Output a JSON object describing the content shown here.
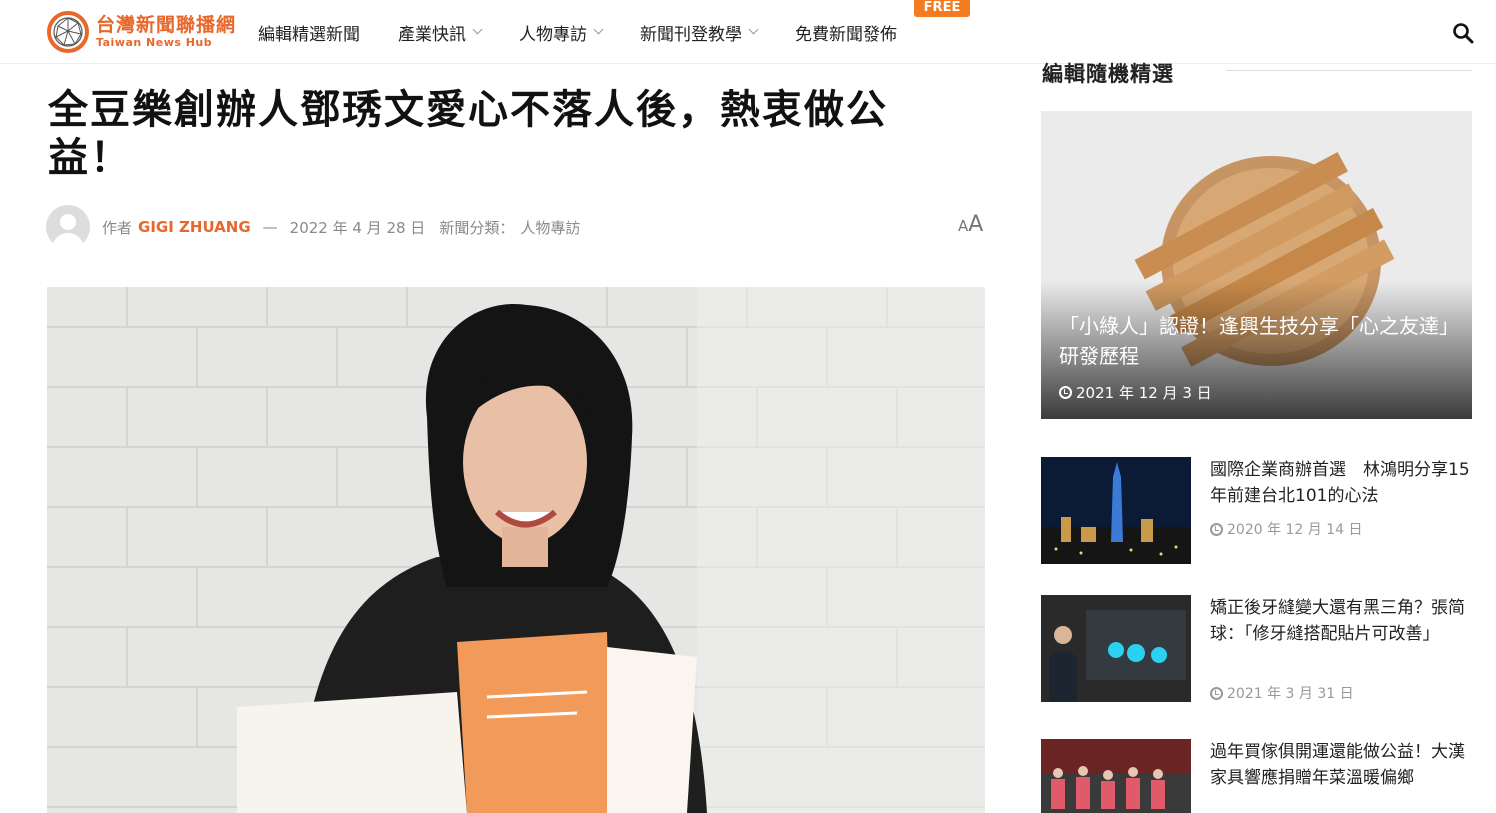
{
  "site": {
    "logo_cn": "台灣新聞聯播網",
    "logo_en": "Taiwan News Hub"
  },
  "nav": {
    "items": [
      {
        "label": "編輯精選新聞",
        "dropdown": false
      },
      {
        "label": "產業快訊",
        "dropdown": true
      },
      {
        "label": "人物專訪",
        "dropdown": true
      },
      {
        "label": "新聞刊登教學",
        "dropdown": true
      },
      {
        "label": "免費新聞發佈",
        "dropdown": false
      }
    ],
    "free_badge": "FREE",
    "search_icon": "search-icon"
  },
  "article": {
    "title": "全豆樂創辦人鄧琇文愛心不落人後，熱衷做公益！",
    "author_prefix": "作者",
    "author": "GIGI ZHUANG",
    "separator": "—",
    "date": "2022 年 4 月 28 日",
    "category_prefix": "新聞分類：",
    "category": "人物專訪",
    "font_size_small": "A",
    "font_size_large": "A"
  },
  "sidebar": {
    "heading": "編輯隨機精選",
    "featured": {
      "title": "「小綠人」認證！逢興生技分享「心之友達」研發歷程",
      "date": "2021 年 12 月 3 日"
    },
    "items": [
      {
        "title": "國際企業商辦首選　林鴻明分享15年前建台北101的心法",
        "date": "2020 年 12 月 14 日"
      },
      {
        "title": "矯正後牙縫變大還有黑三角？張简球：「修牙縫搭配貼片可改善」",
        "date": "2021 年 3 月 31 日"
      },
      {
        "title": "過年買傢俱開運還能做公益！大漢家具響應捐贈年菜溫暖偏鄉",
        "date": ""
      }
    ]
  },
  "colors": {
    "brand": "#e8672b",
    "badge": "#f47b20",
    "text": "#222222",
    "muted": "#8a8a8a"
  }
}
